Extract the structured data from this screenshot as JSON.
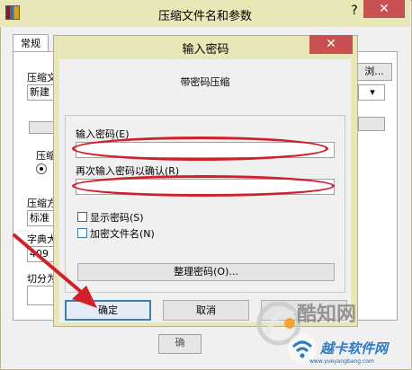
{
  "outer_window": {
    "title": "压缩文件名和参数",
    "help_glyph": "?",
    "close_glyph": "✕",
    "tab_general": "常规",
    "label_archive": "压缩文",
    "value_archive": "新建",
    "browse_button": "浏...",
    "label_format": "压缩",
    "label_method": "压缩方",
    "value_method": "标准",
    "label_dict": "字典大",
    "value_dict": "409",
    "label_split": "切分为",
    "bottom_btn_fragment": "确"
  },
  "dialog": {
    "title": "输入密码",
    "close_glyph": "✕",
    "subtitle": "带密码压缩",
    "password_label": "输入密码(E)",
    "confirm_label": "再次输入密码以确认(R)",
    "show_password_label": "显示密码(S)",
    "encrypt_filenames_label": "加密文件名(N)",
    "organize_button": "整理密码(O)...",
    "ok_button": "确定",
    "cancel_button": "取消"
  },
  "watermark": {
    "line1": "酷知网",
    "line2": "越卡软件网",
    "line3": "www.yueyangbang.com"
  },
  "colors": {
    "annotation_red": "#d0202a",
    "title_bar": "#e9e7b8",
    "close_red": "#c75050"
  }
}
